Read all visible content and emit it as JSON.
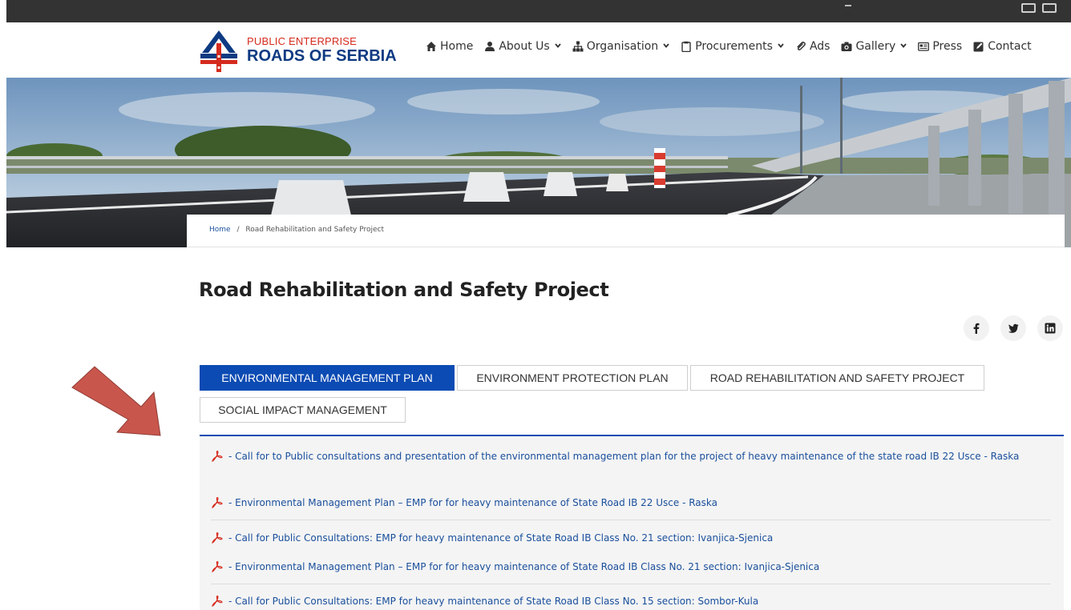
{
  "logo": {
    "line1": "PUBLIC ENTERPRISE",
    "line2": "ROADS OF SERBIA"
  },
  "nav": [
    {
      "label": "Home",
      "icon": "home-icon",
      "dropdown": false
    },
    {
      "label": "About Us",
      "icon": "user-icon",
      "dropdown": true
    },
    {
      "label": "Organisation",
      "icon": "sitemap-icon",
      "dropdown": true
    },
    {
      "label": "Procurements",
      "icon": "clipboard-icon",
      "dropdown": true
    },
    {
      "label": "Ads",
      "icon": "paperclip-icon",
      "dropdown": false
    },
    {
      "label": "Gallery",
      "icon": "camera-icon",
      "dropdown": true
    },
    {
      "label": "Press",
      "icon": "newspaper-icon",
      "dropdown": false
    },
    {
      "label": "Contact",
      "icon": "edit-icon",
      "dropdown": false
    }
  ],
  "breadcrumb": {
    "home": "Home",
    "separator": "/",
    "current": "Road Rehabilitation and Safety Project"
  },
  "page_title": "Road Rehabilitation and Safety Project",
  "share": [
    "facebook-icon",
    "twitter-icon",
    "linkedin-icon"
  ],
  "tabs": [
    {
      "label": "ENVIRONMENTAL MANAGEMENT PLAN",
      "active": true
    },
    {
      "label": "ENVIRONMENT PROTECTION PLAN",
      "active": false
    },
    {
      "label": "ROAD REHABILITATION AND SAFETY PROJECT",
      "active": false
    },
    {
      "label": "SOCIAL IMPACT MANAGEMENT",
      "active": false
    }
  ],
  "documents": [
    {
      "text": "- Call for to Public consultations and presentation of the environmental management plan for the project of heavy maintenance of the state road IB 22 Usce - Raska"
    },
    {
      "text": "- Environmental Management Plan – EMP for for heavy maintenance of State Road IB 22 Usce - Raska"
    },
    {
      "text": "- Call for Public Consultations: EMP for heavy maintenance of State Road IB Class No. 21 section: Ivanjica-Sjenica"
    },
    {
      "text": "- Environmental Management Plan – EMP for for heavy maintenance of State Road IB Class No. 21 section: Ivanjica-Sjenica"
    },
    {
      "text": "- Call for Public Consultations: EMP for heavy maintenance of State Road IB Class No. 15 section: Sombor-Kula"
    }
  ],
  "colors": {
    "brand_blue": "#0b4bb3",
    "logo_red": "#d52b1e",
    "logo_navy": "#0d3a82",
    "arrow_red": "#c9564c",
    "link": "#1a4f9c"
  }
}
